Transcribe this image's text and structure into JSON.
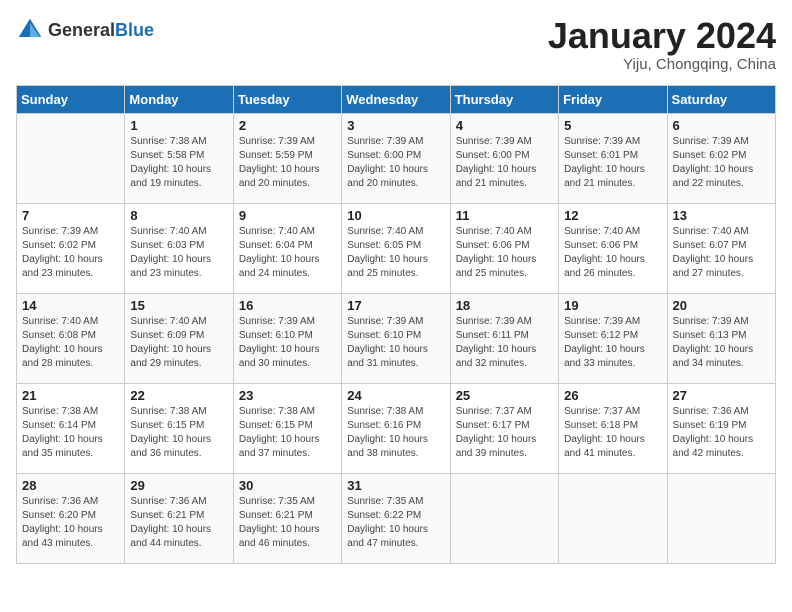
{
  "header": {
    "logo_general": "General",
    "logo_blue": "Blue",
    "month_year": "January 2024",
    "location": "Yiju, Chongqing, China"
  },
  "days_of_week": [
    "Sunday",
    "Monday",
    "Tuesday",
    "Wednesday",
    "Thursday",
    "Friday",
    "Saturday"
  ],
  "weeks": [
    [
      {
        "day": "",
        "sunrise": "",
        "sunset": "",
        "daylight": ""
      },
      {
        "day": "1",
        "sunrise": "7:38 AM",
        "sunset": "5:58 PM",
        "daylight": "10 hours and 19 minutes."
      },
      {
        "day": "2",
        "sunrise": "7:39 AM",
        "sunset": "5:59 PM",
        "daylight": "10 hours and 20 minutes."
      },
      {
        "day": "3",
        "sunrise": "7:39 AM",
        "sunset": "6:00 PM",
        "daylight": "10 hours and 20 minutes."
      },
      {
        "day": "4",
        "sunrise": "7:39 AM",
        "sunset": "6:00 PM",
        "daylight": "10 hours and 21 minutes."
      },
      {
        "day": "5",
        "sunrise": "7:39 AM",
        "sunset": "6:01 PM",
        "daylight": "10 hours and 21 minutes."
      },
      {
        "day": "6",
        "sunrise": "7:39 AM",
        "sunset": "6:02 PM",
        "daylight": "10 hours and 22 minutes."
      }
    ],
    [
      {
        "day": "7",
        "sunrise": "7:39 AM",
        "sunset": "6:02 PM",
        "daylight": "10 hours and 23 minutes."
      },
      {
        "day": "8",
        "sunrise": "7:40 AM",
        "sunset": "6:03 PM",
        "daylight": "10 hours and 23 minutes."
      },
      {
        "day": "9",
        "sunrise": "7:40 AM",
        "sunset": "6:04 PM",
        "daylight": "10 hours and 24 minutes."
      },
      {
        "day": "10",
        "sunrise": "7:40 AM",
        "sunset": "6:05 PM",
        "daylight": "10 hours and 25 minutes."
      },
      {
        "day": "11",
        "sunrise": "7:40 AM",
        "sunset": "6:06 PM",
        "daylight": "10 hours and 25 minutes."
      },
      {
        "day": "12",
        "sunrise": "7:40 AM",
        "sunset": "6:06 PM",
        "daylight": "10 hours and 26 minutes."
      },
      {
        "day": "13",
        "sunrise": "7:40 AM",
        "sunset": "6:07 PM",
        "daylight": "10 hours and 27 minutes."
      }
    ],
    [
      {
        "day": "14",
        "sunrise": "7:40 AM",
        "sunset": "6:08 PM",
        "daylight": "10 hours and 28 minutes."
      },
      {
        "day": "15",
        "sunrise": "7:40 AM",
        "sunset": "6:09 PM",
        "daylight": "10 hours and 29 minutes."
      },
      {
        "day": "16",
        "sunrise": "7:39 AM",
        "sunset": "6:10 PM",
        "daylight": "10 hours and 30 minutes."
      },
      {
        "day": "17",
        "sunrise": "7:39 AM",
        "sunset": "6:10 PM",
        "daylight": "10 hours and 31 minutes."
      },
      {
        "day": "18",
        "sunrise": "7:39 AM",
        "sunset": "6:11 PM",
        "daylight": "10 hours and 32 minutes."
      },
      {
        "day": "19",
        "sunrise": "7:39 AM",
        "sunset": "6:12 PM",
        "daylight": "10 hours and 33 minutes."
      },
      {
        "day": "20",
        "sunrise": "7:39 AM",
        "sunset": "6:13 PM",
        "daylight": "10 hours and 34 minutes."
      }
    ],
    [
      {
        "day": "21",
        "sunrise": "7:38 AM",
        "sunset": "6:14 PM",
        "daylight": "10 hours and 35 minutes."
      },
      {
        "day": "22",
        "sunrise": "7:38 AM",
        "sunset": "6:15 PM",
        "daylight": "10 hours and 36 minutes."
      },
      {
        "day": "23",
        "sunrise": "7:38 AM",
        "sunset": "6:15 PM",
        "daylight": "10 hours and 37 minutes."
      },
      {
        "day": "24",
        "sunrise": "7:38 AM",
        "sunset": "6:16 PM",
        "daylight": "10 hours and 38 minutes."
      },
      {
        "day": "25",
        "sunrise": "7:37 AM",
        "sunset": "6:17 PM",
        "daylight": "10 hours and 39 minutes."
      },
      {
        "day": "26",
        "sunrise": "7:37 AM",
        "sunset": "6:18 PM",
        "daylight": "10 hours and 41 minutes."
      },
      {
        "day": "27",
        "sunrise": "7:36 AM",
        "sunset": "6:19 PM",
        "daylight": "10 hours and 42 minutes."
      }
    ],
    [
      {
        "day": "28",
        "sunrise": "7:36 AM",
        "sunset": "6:20 PM",
        "daylight": "10 hours and 43 minutes."
      },
      {
        "day": "29",
        "sunrise": "7:36 AM",
        "sunset": "6:21 PM",
        "daylight": "10 hours and 44 minutes."
      },
      {
        "day": "30",
        "sunrise": "7:35 AM",
        "sunset": "6:21 PM",
        "daylight": "10 hours and 46 minutes."
      },
      {
        "day": "31",
        "sunrise": "7:35 AM",
        "sunset": "6:22 PM",
        "daylight": "10 hours and 47 minutes."
      },
      {
        "day": "",
        "sunrise": "",
        "sunset": "",
        "daylight": ""
      },
      {
        "day": "",
        "sunrise": "",
        "sunset": "",
        "daylight": ""
      },
      {
        "day": "",
        "sunrise": "",
        "sunset": "",
        "daylight": ""
      }
    ]
  ]
}
